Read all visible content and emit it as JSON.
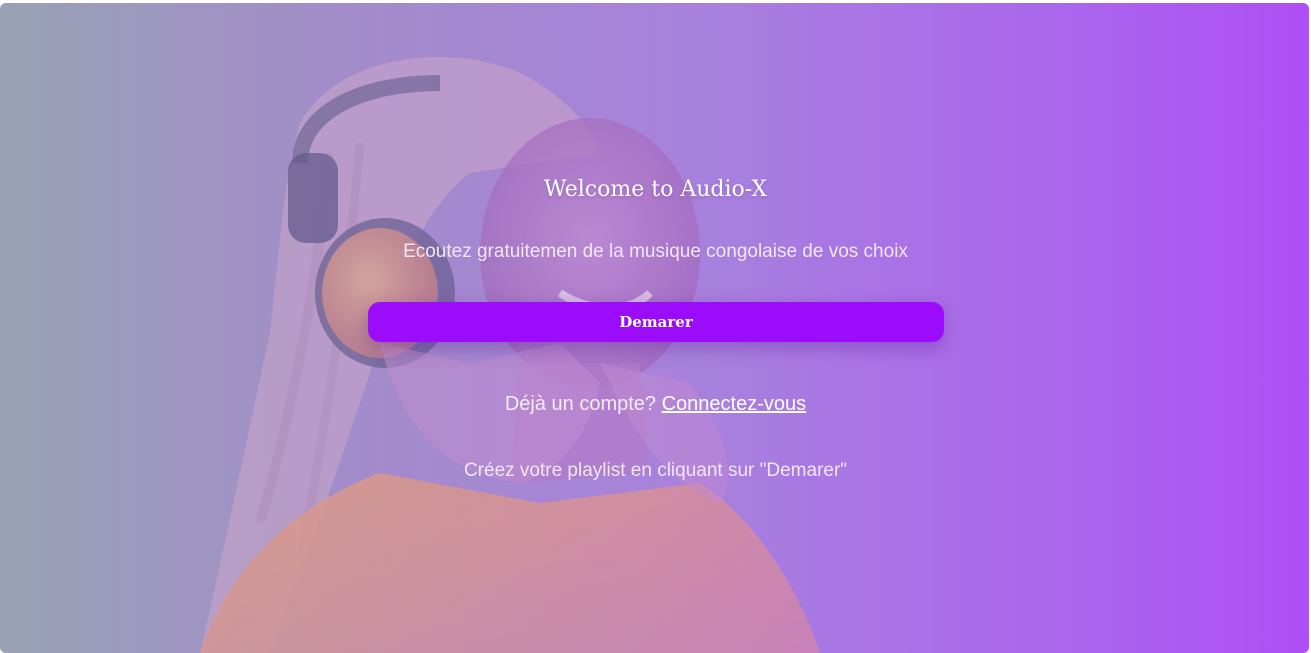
{
  "colors": {
    "button_bg": "#9b0cfb",
    "accent_right": "#ad4ff5",
    "accent_left": "#9aa3b5"
  },
  "hero": {
    "image_alt_icon": "woman-with-headphones-photo",
    "title": "Welcome to Audio-X",
    "subtitle": "Ecoutez gratuitemen de la musique congolaise de vos choix"
  },
  "actions": {
    "start_label": "Demarer"
  },
  "account": {
    "prompt": "Déjà un compte?",
    "login_link": "Connectez-vous"
  },
  "footer_hint": "Créez votre playlist en cliquant sur \"Demarer\""
}
